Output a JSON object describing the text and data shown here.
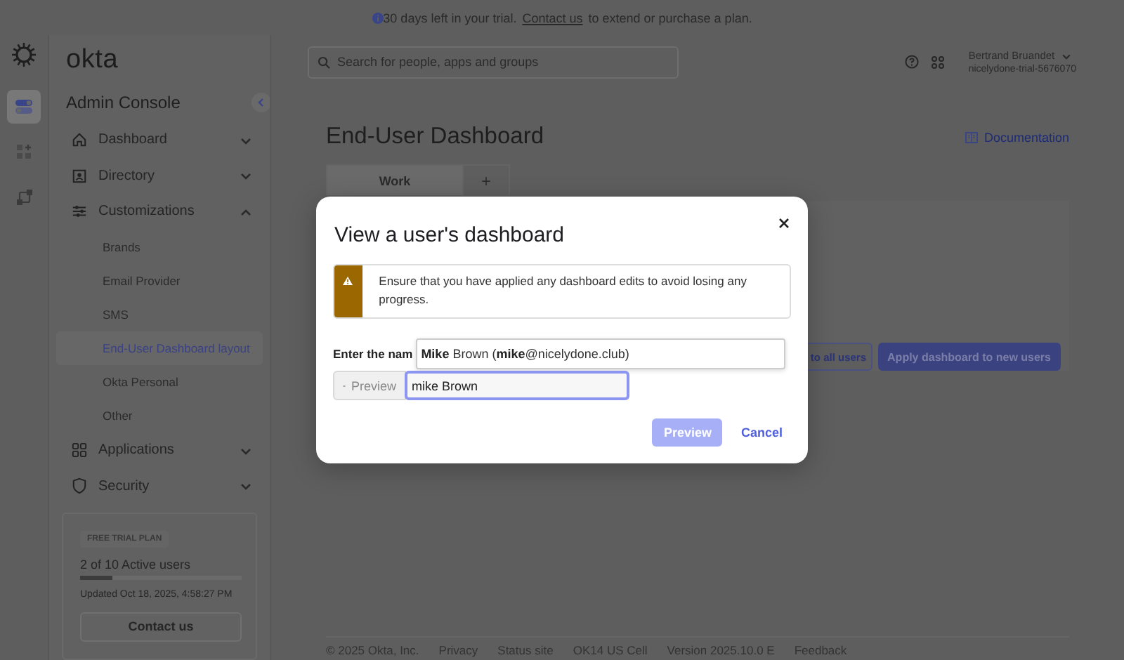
{
  "banner": {
    "text": "30 days left in your trial.",
    "link": "Contact us",
    "text_after": "to extend or purchase a plan."
  },
  "rail": {
    "items": [
      {
        "selected": true
      },
      {
        "selected": false
      },
      {
        "selected": false
      }
    ]
  },
  "header": {
    "search_placeholder": "Search for people, apps and groups",
    "user_name": "Bertrand Bruandet",
    "org": "nicelydone-trial-5676070"
  },
  "sidebar": {
    "logo": "okta",
    "title": "Admin Console",
    "items": [
      {
        "label": "Dashboard",
        "expanded": false
      },
      {
        "label": "Directory",
        "expanded": false
      },
      {
        "label": "Customizations",
        "expanded": true,
        "children": [
          {
            "label": "Brands",
            "selected": false
          },
          {
            "label": "Email Provider",
            "selected": false
          },
          {
            "label": "SMS",
            "selected": false
          },
          {
            "label": "End-User Dashboard layout",
            "selected": true
          },
          {
            "label": "Okta Personal",
            "selected": false
          },
          {
            "label": "Other",
            "selected": false
          }
        ]
      },
      {
        "label": "Applications",
        "expanded": false
      },
      {
        "label": "Security",
        "expanded": false
      }
    ]
  },
  "trial": {
    "badge": "FREE TRIAL PLAN",
    "users": "2 of 10 Active users",
    "level": 0.2,
    "updated": "Updated Oct 18, 2025, 4:58:27 PM",
    "button": "Contact us"
  },
  "page": {
    "title": "End-User Dashboard",
    "doc_link": "Documentation",
    "tabs": [
      {
        "label": "Work",
        "selected": true
      }
    ],
    "add_tab": "+",
    "buttons": [
      {
        "label": "to all users",
        "kind": "secondary"
      },
      {
        "label": "Apply dashboard to new users",
        "kind": "primary"
      }
    ]
  },
  "footer": [
    "© 2025 Okta, Inc.",
    "Privacy",
    "Status site",
    "OK14 US Cell",
    "Version 2025.10.0 E",
    "Feedback"
  ],
  "modal": {
    "title": "View a user's dashboard",
    "warning": "Ensure that you have applied any dashboard edits to avoid losing any progress.",
    "label": "Enter the nam",
    "preview_small": "Preview",
    "input_value": "mike Brown",
    "suggestion": "**Mike** Brown (**mike**@nicelydone.club)",
    "primary": {
      "label": "Preview",
      "disabled": true
    },
    "cancel": "Cancel"
  }
}
